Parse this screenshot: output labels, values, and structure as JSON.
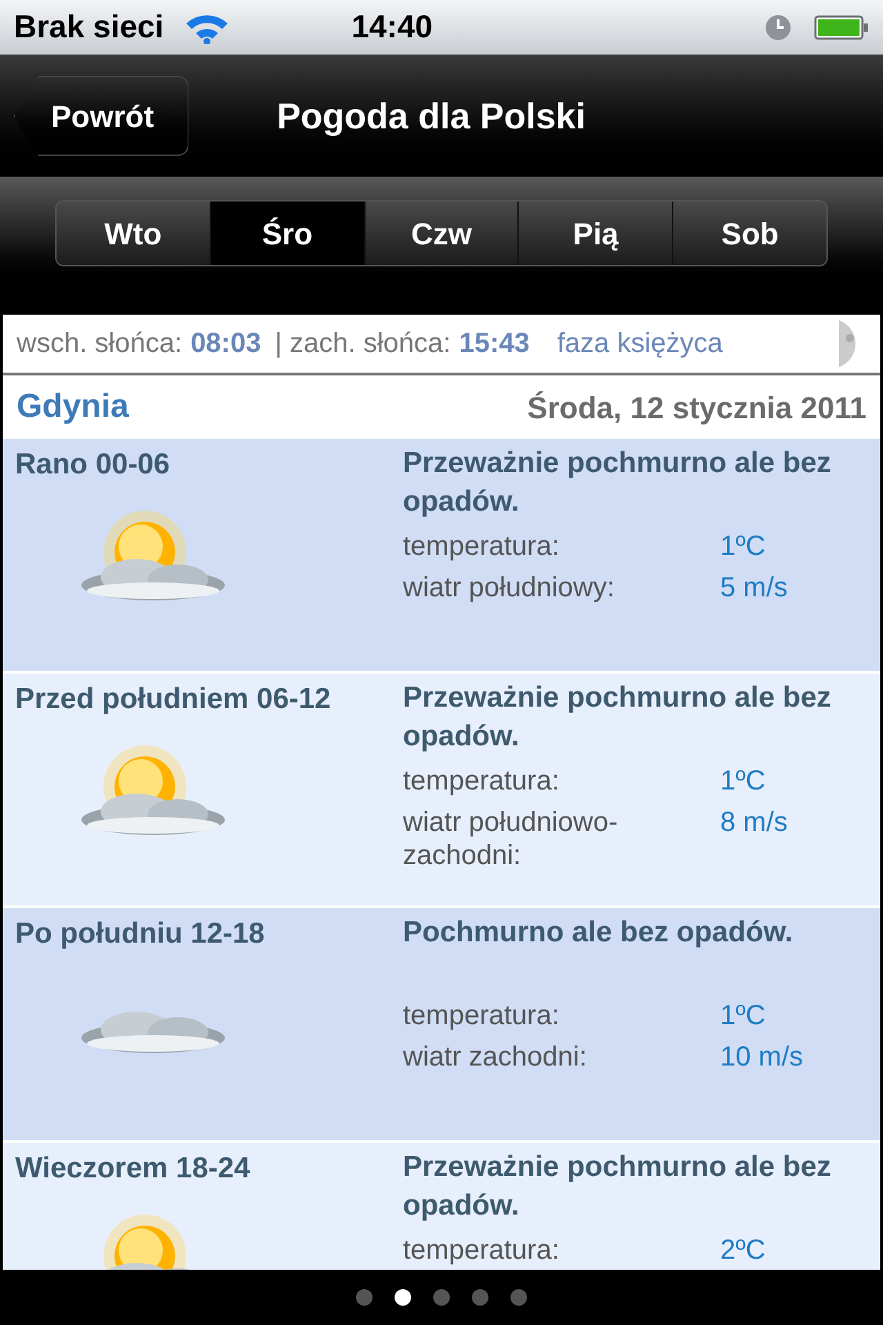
{
  "status_bar": {
    "carrier": "Brak sieci",
    "time": "14:40"
  },
  "nav_bar": {
    "back": "Powrót",
    "title": "Pogoda dla Polski"
  },
  "tabs": [
    {
      "label": "Wto",
      "selected": false
    },
    {
      "label": "Śro",
      "selected": true
    },
    {
      "label": "Czw",
      "selected": false
    },
    {
      "label": "Pią",
      "selected": false
    },
    {
      "label": "Sob",
      "selected": false
    }
  ],
  "sun_info": {
    "sunrise_label": "wsch. słońca:",
    "sunrise": "08:03",
    "sunset_label": "| zach. słońca:",
    "sunset": "15:43",
    "moon_label": "faza księżyca"
  },
  "city": "Gdynia",
  "date": "Środa, 12 stycznia 2011",
  "periods": [
    {
      "name": "Rano 00-06",
      "kind": "partly-cloudy",
      "summary": "Przeważnie pochmurno ale bez opadów.",
      "details": [
        {
          "label": "temperatura:",
          "value": "1ºC"
        },
        {
          "label": "wiatr południowy:",
          "value": "5 m/s"
        }
      ]
    },
    {
      "name": "Przed południem 06-12",
      "kind": "partly-cloudy",
      "summary": "Przeważnie pochmurno ale bez opadów.",
      "details": [
        {
          "label": "temperatura:",
          "value": "1ºC"
        },
        {
          "label": "wiatr południowo-zachodni:",
          "value": "8 m/s"
        }
      ]
    },
    {
      "name": "Po południu 12-18",
      "kind": "cloudy",
      "summary": "Pochmurno ale bez opadów.",
      "details": [
        {
          "label": "temperatura:",
          "value": "1ºC"
        },
        {
          "label": "wiatr zachodni:",
          "value": "10 m/s"
        }
      ]
    },
    {
      "name": "Wieczorem 18-24",
      "kind": "partly-cloudy",
      "summary": "Przeważnie pochmurno ale bez opadów.",
      "details": [
        {
          "label": "temperatura:",
          "value": "2ºC"
        }
      ]
    }
  ],
  "pages": [
    {
      "selected": false
    },
    {
      "selected": true
    },
    {
      "selected": false
    },
    {
      "selected": false
    },
    {
      "selected": false
    }
  ]
}
